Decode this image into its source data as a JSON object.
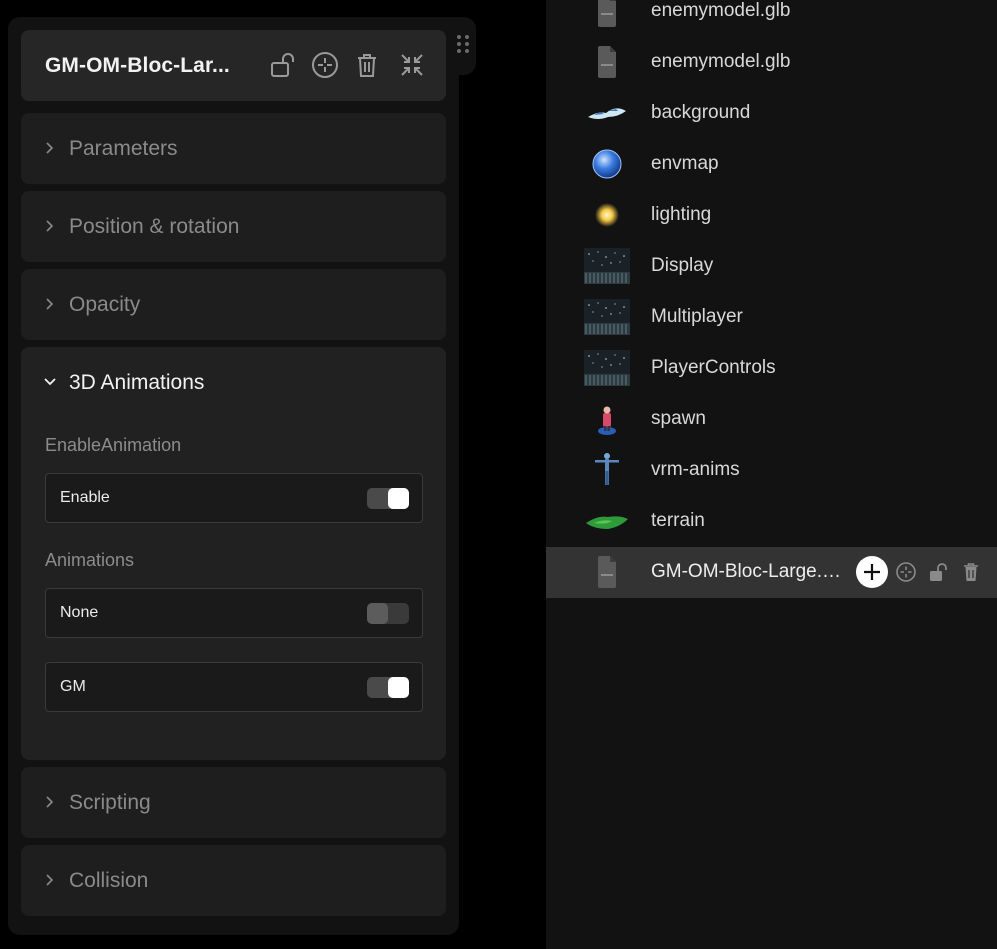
{
  "panel": {
    "title": "GM-OM-Bloc-Lar...",
    "header_icons": [
      "unlock-icon",
      "target-icon",
      "trash-icon",
      "collapse-icon"
    ],
    "sections": [
      {
        "label": "Parameters",
        "expanded": false
      },
      {
        "label": "Position & rotation",
        "expanded": false
      },
      {
        "label": "Opacity",
        "expanded": false
      },
      {
        "label": "3D Animations",
        "expanded": true
      },
      {
        "label": "Scripting",
        "expanded": false
      },
      {
        "label": "Collision",
        "expanded": false
      }
    ],
    "animations": {
      "enable_group_label": "EnableAnimation",
      "enable": {
        "label": "Enable",
        "on": true
      },
      "animations_group_label": "Animations",
      "options": [
        {
          "label": "None",
          "on": false
        },
        {
          "label": "GM",
          "on": true
        }
      ]
    }
  },
  "scene": {
    "items": [
      {
        "name": "enemymodel.glb",
        "thumb": "file-icon"
      },
      {
        "name": "enemymodel.glb",
        "thumb": "file-icon"
      },
      {
        "name": "background",
        "thumb": "background-thumbnail"
      },
      {
        "name": "envmap",
        "thumb": "globe-thumbnail"
      },
      {
        "name": "lighting",
        "thumb": "light-bulb-thumbnail"
      },
      {
        "name": "Display",
        "thumb": "starfield-thumbnail"
      },
      {
        "name": "Multiplayer",
        "thumb": "starfield-thumbnail"
      },
      {
        "name": "PlayerControls",
        "thumb": "starfield-thumbnail"
      },
      {
        "name": "spawn",
        "thumb": "spawn-avatar-thumbnail"
      },
      {
        "name": "vrm-anims",
        "thumb": "tpose-avatar-thumbnail"
      },
      {
        "name": "terrain",
        "thumb": "terrain-thumbnail"
      },
      {
        "name": "GM-OM-Bloc-Large.glb",
        "thumb": "file-icon",
        "selected": true
      }
    ],
    "row_actions": [
      "add-icon",
      "target-icon",
      "unlock-icon",
      "trash-icon"
    ]
  },
  "colors": {
    "background": "#000000",
    "panel": "#121212",
    "header": "#262626",
    "section": "#1e1e1e",
    "selected_row": "#333333",
    "toggle_on_knob": "#ffffff"
  }
}
